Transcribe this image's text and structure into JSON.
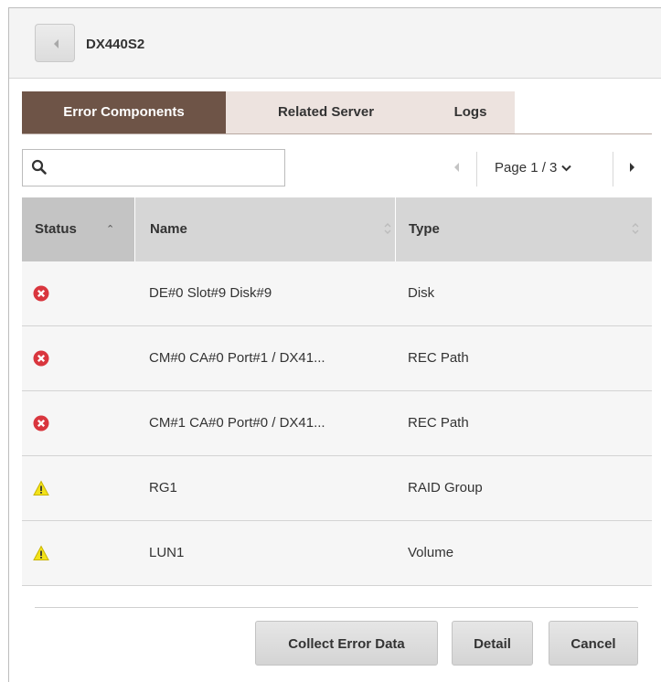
{
  "header": {
    "title": "DX440S2"
  },
  "tabs": [
    {
      "label": "Error Components",
      "active": true
    },
    {
      "label": "Related Server",
      "active": false
    },
    {
      "label": "Logs",
      "active": false
    }
  ],
  "search": {
    "value": "",
    "placeholder": ""
  },
  "pagination": {
    "label": "Page 1 / 3",
    "current": 1,
    "total": 3
  },
  "table": {
    "columns": [
      "Status",
      "Name",
      "Type"
    ],
    "rows": [
      {
        "status": "error",
        "name": "DE#0 Slot#9 Disk#9",
        "type": "Disk"
      },
      {
        "status": "error",
        "name": "CM#0 CA#0 Port#1 / DX41...",
        "type": "REC Path"
      },
      {
        "status": "error",
        "name": "CM#1 CA#0 Port#0 / DX41...",
        "type": "REC Path"
      },
      {
        "status": "warning",
        "name": "RG1",
        "type": "RAID Group"
      },
      {
        "status": "warning",
        "name": "LUN1",
        "type": "Volume"
      }
    ]
  },
  "buttons": {
    "collect_error_data": "Collect Error Data",
    "detail": "Detail",
    "cancel": "Cancel"
  },
  "colors": {
    "tab_active": "#6e5447",
    "tab_inactive": "#ede3df",
    "error_icon": "#d9363e",
    "warning_icon": "#f2e21a"
  },
  "icons": {
    "back": "back-arrow-icon",
    "search": "search-icon",
    "error": "error-icon",
    "warning": "warning-icon"
  }
}
